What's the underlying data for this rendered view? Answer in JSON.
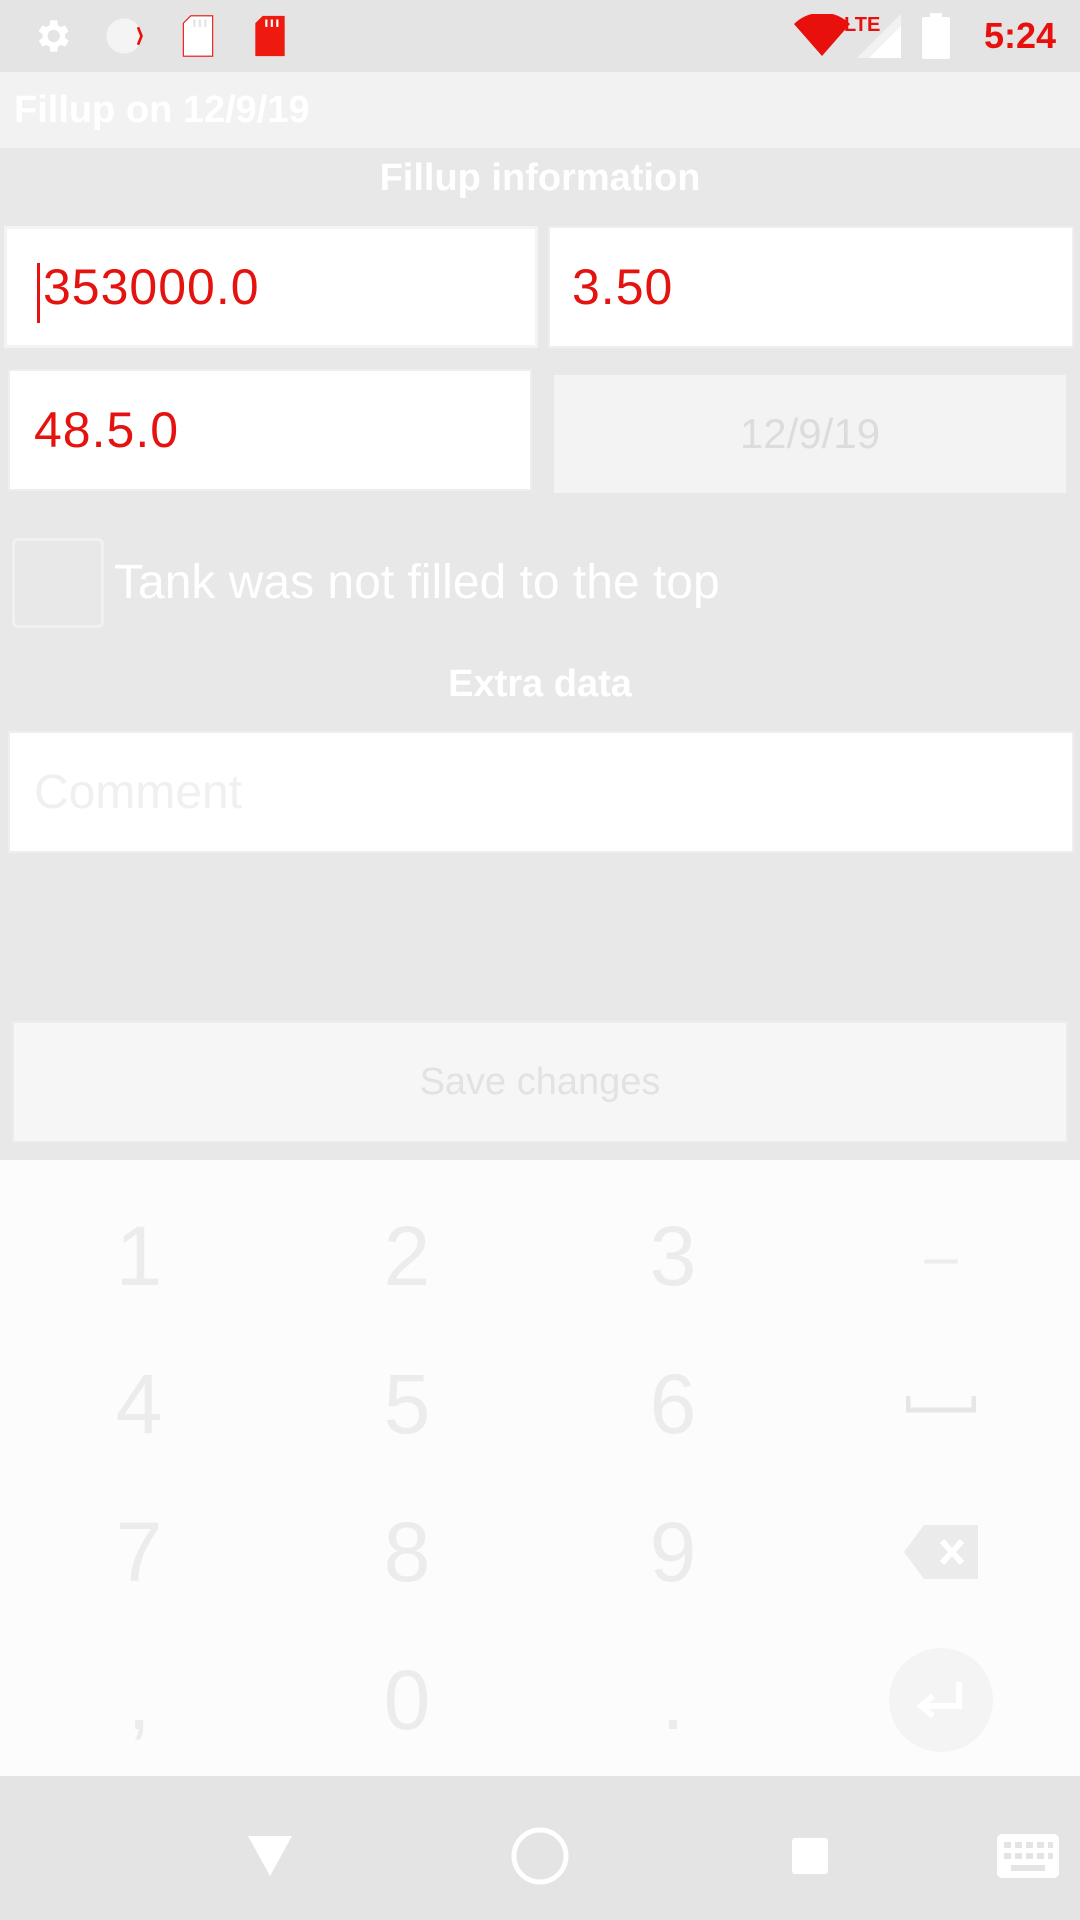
{
  "status_bar": {
    "time": "5:24",
    "icons": [
      "settings-icon",
      "circle-icon",
      "sd-card-icon",
      "sd-card-icon",
      "wifi-icon",
      "lte-signal-icon",
      "battery-icon"
    ],
    "network_label": "LTE"
  },
  "action_bar": {
    "title": "Fillup on 12/9/19"
  },
  "fillup_section": {
    "title": "Fillup information",
    "odometer_value": "353000.0",
    "price_value": "3.50",
    "volume_value": "48.5.0",
    "date_value": "12/9/19",
    "partial_fill_label": "Tank was not filled to the top",
    "partial_fill_checked": false
  },
  "extra_section": {
    "title": "Extra data",
    "comment_placeholder": "Comment",
    "comment_value": ""
  },
  "save_button_label": "Save changes",
  "keyboard": {
    "rows": [
      [
        "1",
        "2",
        "3",
        "–"
      ],
      [
        "4",
        "5",
        "6",
        "space-icon"
      ],
      [
        "7",
        "8",
        "9",
        "backspace-icon"
      ],
      [
        ",",
        "0",
        ".",
        "enter-icon"
      ]
    ]
  },
  "nav_bar": {
    "icons": [
      "back-icon",
      "home-icon",
      "recents-icon",
      "keyboard-icon"
    ]
  },
  "colors": {
    "accent": "#e5130f",
    "background": "#e8e8e8",
    "field_bg": "#ffffff"
  }
}
